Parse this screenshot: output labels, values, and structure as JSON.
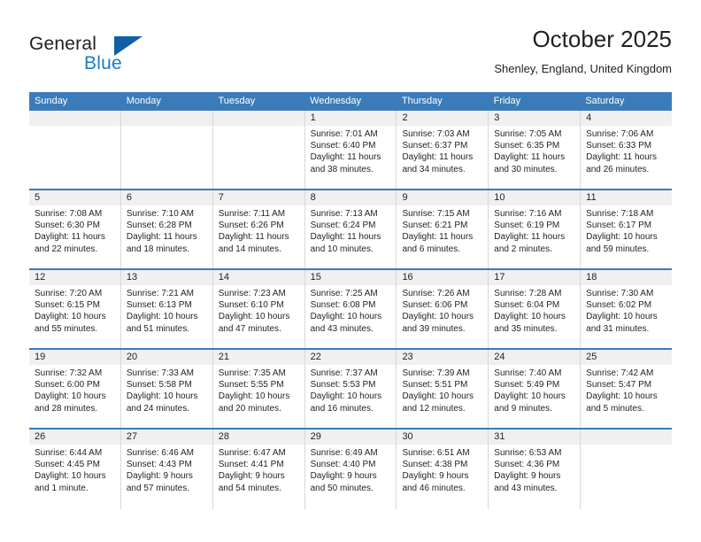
{
  "brand": {
    "name_part1": "General",
    "name_part2": "Blue",
    "triangle_color": "#1060a8",
    "blue_color": "#1b7bc4"
  },
  "header": {
    "title": "October 2025",
    "location": "Shenley, England, United Kingdom"
  },
  "theme": {
    "header_row_bg": "#3b7cb8",
    "day_number_bg": "#f0f0f0",
    "row_divider": "#3b7cb8",
    "column_divider": "#d8d8d8",
    "text": "#231f20"
  },
  "weekdays": [
    "Sunday",
    "Monday",
    "Tuesday",
    "Wednesday",
    "Thursday",
    "Friday",
    "Saturday"
  ],
  "labels": {
    "sunrise_prefix": "Sunrise:",
    "sunset_prefix": "Sunset:",
    "daylight_prefix": "Daylight:"
  },
  "weeks": [
    [
      {
        "empty": true
      },
      {
        "empty": true
      },
      {
        "empty": true
      },
      {
        "day": "1",
        "sunrise": "Sunrise: 7:01 AM",
        "sunset": "Sunset: 6:40 PM",
        "daylight": "Daylight: 11 hours and 38 minutes."
      },
      {
        "day": "2",
        "sunrise": "Sunrise: 7:03 AM",
        "sunset": "Sunset: 6:37 PM",
        "daylight": "Daylight: 11 hours and 34 minutes."
      },
      {
        "day": "3",
        "sunrise": "Sunrise: 7:05 AM",
        "sunset": "Sunset: 6:35 PM",
        "daylight": "Daylight: 11 hours and 30 minutes."
      },
      {
        "day": "4",
        "sunrise": "Sunrise: 7:06 AM",
        "sunset": "Sunset: 6:33 PM",
        "daylight": "Daylight: 11 hours and 26 minutes."
      }
    ],
    [
      {
        "day": "5",
        "sunrise": "Sunrise: 7:08 AM",
        "sunset": "Sunset: 6:30 PM",
        "daylight": "Daylight: 11 hours and 22 minutes."
      },
      {
        "day": "6",
        "sunrise": "Sunrise: 7:10 AM",
        "sunset": "Sunset: 6:28 PM",
        "daylight": "Daylight: 11 hours and 18 minutes."
      },
      {
        "day": "7",
        "sunrise": "Sunrise: 7:11 AM",
        "sunset": "Sunset: 6:26 PM",
        "daylight": "Daylight: 11 hours and 14 minutes."
      },
      {
        "day": "8",
        "sunrise": "Sunrise: 7:13 AM",
        "sunset": "Sunset: 6:24 PM",
        "daylight": "Daylight: 11 hours and 10 minutes."
      },
      {
        "day": "9",
        "sunrise": "Sunrise: 7:15 AM",
        "sunset": "Sunset: 6:21 PM",
        "daylight": "Daylight: 11 hours and 6 minutes."
      },
      {
        "day": "10",
        "sunrise": "Sunrise: 7:16 AM",
        "sunset": "Sunset: 6:19 PM",
        "daylight": "Daylight: 11 hours and 2 minutes."
      },
      {
        "day": "11",
        "sunrise": "Sunrise: 7:18 AM",
        "sunset": "Sunset: 6:17 PM",
        "daylight": "Daylight: 10 hours and 59 minutes."
      }
    ],
    [
      {
        "day": "12",
        "sunrise": "Sunrise: 7:20 AM",
        "sunset": "Sunset: 6:15 PM",
        "daylight": "Daylight: 10 hours and 55 minutes."
      },
      {
        "day": "13",
        "sunrise": "Sunrise: 7:21 AM",
        "sunset": "Sunset: 6:13 PM",
        "daylight": "Daylight: 10 hours and 51 minutes."
      },
      {
        "day": "14",
        "sunrise": "Sunrise: 7:23 AM",
        "sunset": "Sunset: 6:10 PM",
        "daylight": "Daylight: 10 hours and 47 minutes."
      },
      {
        "day": "15",
        "sunrise": "Sunrise: 7:25 AM",
        "sunset": "Sunset: 6:08 PM",
        "daylight": "Daylight: 10 hours and 43 minutes."
      },
      {
        "day": "16",
        "sunrise": "Sunrise: 7:26 AM",
        "sunset": "Sunset: 6:06 PM",
        "daylight": "Daylight: 10 hours and 39 minutes."
      },
      {
        "day": "17",
        "sunrise": "Sunrise: 7:28 AM",
        "sunset": "Sunset: 6:04 PM",
        "daylight": "Daylight: 10 hours and 35 minutes."
      },
      {
        "day": "18",
        "sunrise": "Sunrise: 7:30 AM",
        "sunset": "Sunset: 6:02 PM",
        "daylight": "Daylight: 10 hours and 31 minutes."
      }
    ],
    [
      {
        "day": "19",
        "sunrise": "Sunrise: 7:32 AM",
        "sunset": "Sunset: 6:00 PM",
        "daylight": "Daylight: 10 hours and 28 minutes."
      },
      {
        "day": "20",
        "sunrise": "Sunrise: 7:33 AM",
        "sunset": "Sunset: 5:58 PM",
        "daylight": "Daylight: 10 hours and 24 minutes."
      },
      {
        "day": "21",
        "sunrise": "Sunrise: 7:35 AM",
        "sunset": "Sunset: 5:55 PM",
        "daylight": "Daylight: 10 hours and 20 minutes."
      },
      {
        "day": "22",
        "sunrise": "Sunrise: 7:37 AM",
        "sunset": "Sunset: 5:53 PM",
        "daylight": "Daylight: 10 hours and 16 minutes."
      },
      {
        "day": "23",
        "sunrise": "Sunrise: 7:39 AM",
        "sunset": "Sunset: 5:51 PM",
        "daylight": "Daylight: 10 hours and 12 minutes."
      },
      {
        "day": "24",
        "sunrise": "Sunrise: 7:40 AM",
        "sunset": "Sunset: 5:49 PM",
        "daylight": "Daylight: 10 hours and 9 minutes."
      },
      {
        "day": "25",
        "sunrise": "Sunrise: 7:42 AM",
        "sunset": "Sunset: 5:47 PM",
        "daylight": "Daylight: 10 hours and 5 minutes."
      }
    ],
    [
      {
        "day": "26",
        "sunrise": "Sunrise: 6:44 AM",
        "sunset": "Sunset: 4:45 PM",
        "daylight": "Daylight: 10 hours and 1 minute."
      },
      {
        "day": "27",
        "sunrise": "Sunrise: 6:46 AM",
        "sunset": "Sunset: 4:43 PM",
        "daylight": "Daylight: 9 hours and 57 minutes."
      },
      {
        "day": "28",
        "sunrise": "Sunrise: 6:47 AM",
        "sunset": "Sunset: 4:41 PM",
        "daylight": "Daylight: 9 hours and 54 minutes."
      },
      {
        "day": "29",
        "sunrise": "Sunrise: 6:49 AM",
        "sunset": "Sunset: 4:40 PM",
        "daylight": "Daylight: 9 hours and 50 minutes."
      },
      {
        "day": "30",
        "sunrise": "Sunrise: 6:51 AM",
        "sunset": "Sunset: 4:38 PM",
        "daylight": "Daylight: 9 hours and 46 minutes."
      },
      {
        "day": "31",
        "sunrise": "Sunrise: 6:53 AM",
        "sunset": "Sunset: 4:36 PM",
        "daylight": "Daylight: 9 hours and 43 minutes."
      },
      {
        "empty": true
      }
    ]
  ]
}
